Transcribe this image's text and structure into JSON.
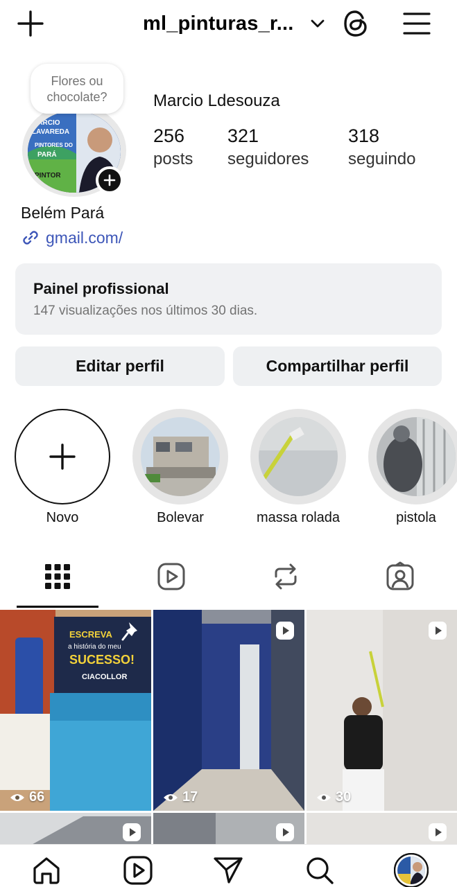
{
  "header": {
    "username": "ml_pinturas_r...",
    "icons": [
      "plus-icon",
      "chevron-down-icon",
      "threads-icon",
      "menu-icon"
    ]
  },
  "profile": {
    "note": "Flores ou chocolate?",
    "full_name": "Marcio Ldesouza",
    "stats": {
      "posts": {
        "value": "256",
        "label": "posts"
      },
      "followers": {
        "value": "321",
        "label": "seguidores"
      },
      "following": {
        "value": "318",
        "label": "seguindo"
      }
    },
    "location": "Belém Pará",
    "link": "gmail.com/",
    "avatar_text": [
      "MARCIO",
      "LAVAREDA",
      "PINTORES DO",
      "PARÁ",
      "PINTOR"
    ]
  },
  "panel": {
    "title": "Painel profissional",
    "subtitle": "147 visualizações nos últimos 30 dias."
  },
  "buttons": {
    "edit": "Editar perfil",
    "share": "Compartilhar perfil"
  },
  "highlights": [
    {
      "label": "Novo"
    },
    {
      "label": "Bolevar"
    },
    {
      "label": "massa rolada"
    },
    {
      "label": "pistola"
    }
  ],
  "tabs": [
    "grid-icon",
    "reels-icon",
    "reposts-icon",
    "tagged-icon"
  ],
  "posts": [
    {
      "views": "66",
      "pinned": true,
      "overlay_texts": [
        "ESCREVA",
        "a história do meu",
        "SUCESSO!",
        "CIACOLLOR"
      ]
    },
    {
      "views": "17",
      "pinned": false
    },
    {
      "views": "30",
      "pinned": false
    }
  ],
  "colors": {
    "link": "#3d56b8",
    "panel_bg": "#f0f1f3",
    "button_bg": "#eef0f2",
    "muted_text": "#737373"
  },
  "bottom_nav": [
    "home-icon",
    "reels-icon",
    "send-icon",
    "search-icon",
    "profile-avatar"
  ]
}
